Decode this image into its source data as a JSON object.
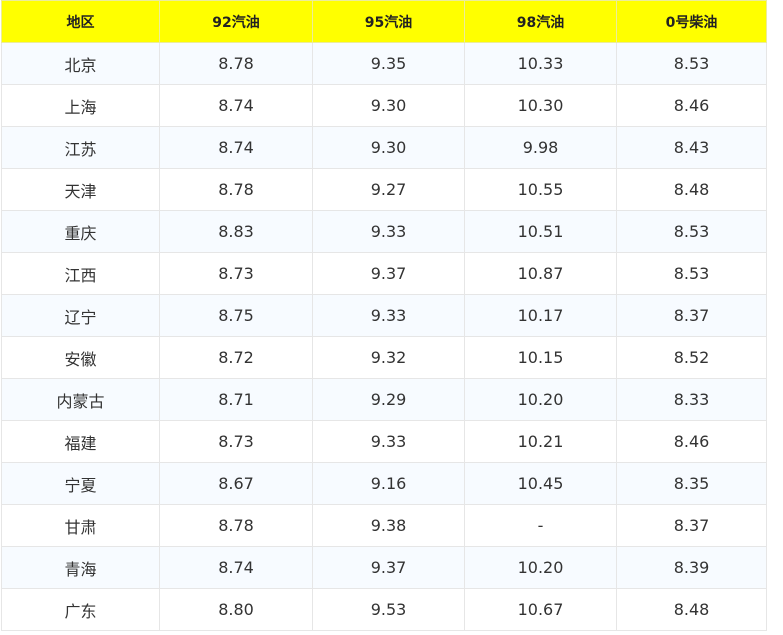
{
  "table": {
    "headers": [
      "地区",
      "92汽油",
      "95汽油",
      "98汽油",
      "0号柴油"
    ],
    "rows": [
      [
        "北京",
        "8.78",
        "9.35",
        "10.33",
        "8.53"
      ],
      [
        "上海",
        "8.74",
        "9.30",
        "10.30",
        "8.46"
      ],
      [
        "江苏",
        "8.74",
        "9.30",
        "9.98",
        "8.43"
      ],
      [
        "天津",
        "8.78",
        "9.27",
        "10.55",
        "8.48"
      ],
      [
        "重庆",
        "8.83",
        "9.33",
        "10.51",
        "8.53"
      ],
      [
        "江西",
        "8.73",
        "9.37",
        "10.87",
        "8.53"
      ],
      [
        "辽宁",
        "8.75",
        "9.33",
        "10.17",
        "8.37"
      ],
      [
        "安徽",
        "8.72",
        "9.32",
        "10.15",
        "8.52"
      ],
      [
        "内蒙古",
        "8.71",
        "9.29",
        "10.20",
        "8.33"
      ],
      [
        "福建",
        "8.73",
        "9.33",
        "10.21",
        "8.46"
      ],
      [
        "宁夏",
        "8.67",
        "9.16",
        "10.45",
        "8.35"
      ],
      [
        "甘肃",
        "8.78",
        "9.38",
        "-",
        "8.37"
      ],
      [
        "青海",
        "8.74",
        "9.37",
        "10.20",
        "8.39"
      ],
      [
        "广东",
        "8.80",
        "9.53",
        "10.67",
        "8.48"
      ]
    ]
  },
  "colors": {
    "header_background": "#ffff00",
    "row_alt_background": "#f7fbff",
    "row_background": "#ffffff",
    "border": "#e6e6e6",
    "text": "#333333"
  }
}
